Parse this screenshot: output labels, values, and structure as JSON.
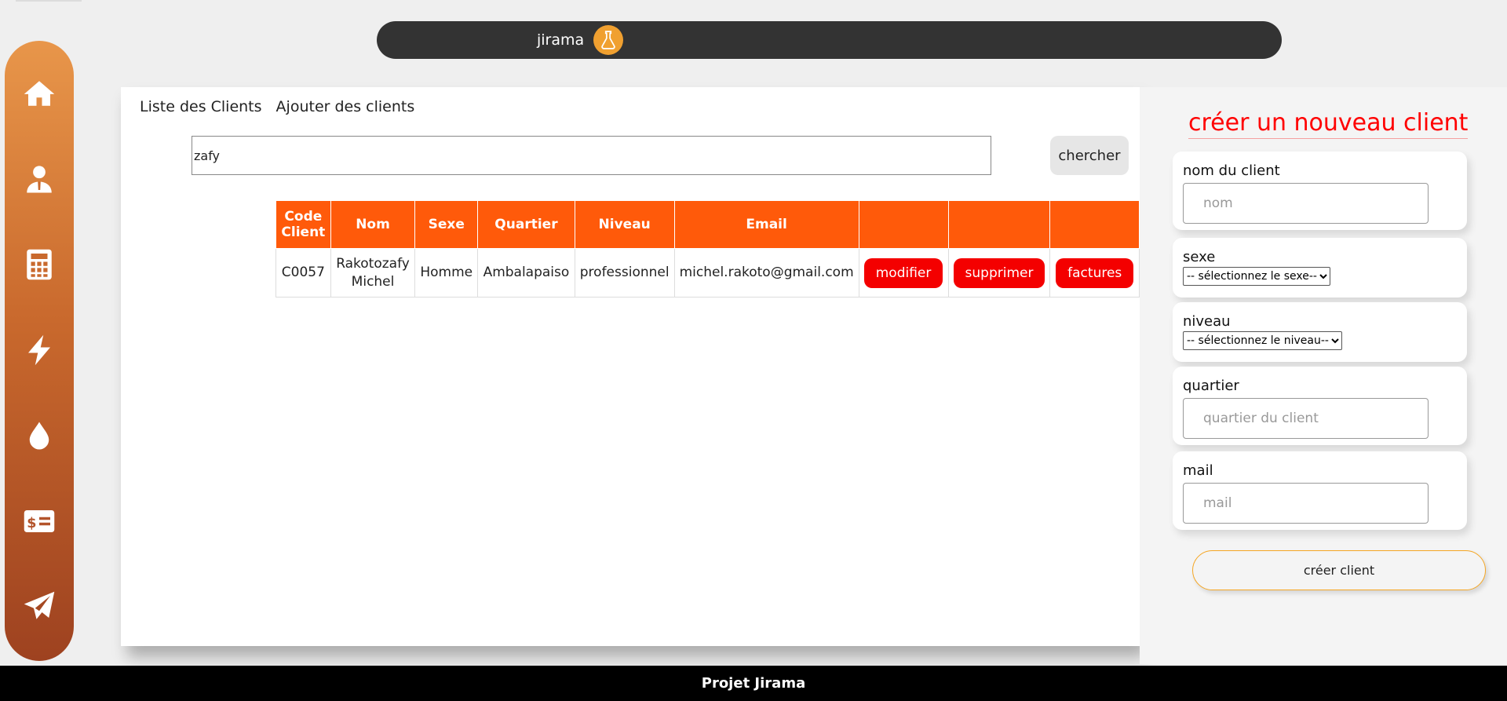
{
  "header": {
    "title": "jirama"
  },
  "sidebar": {
    "items": [
      "home-icon",
      "user-tie-icon",
      "calculator-icon",
      "bolt-icon",
      "droplet-icon",
      "money-bill-icon",
      "paper-plane-icon"
    ]
  },
  "tabs": {
    "list": "Liste des Clients",
    "add": "Ajouter des clients"
  },
  "search": {
    "value": "zafy",
    "button": "chercher"
  },
  "table": {
    "headers": [
      "Code Client",
      "Nom",
      "Sexe",
      "Quartier",
      "Niveau",
      "Email",
      "",
      "",
      ""
    ],
    "rows": [
      {
        "code": "C0057",
        "nom": "Rakotozafy Michel",
        "sexe": "Homme",
        "quartier": "Ambalapaiso",
        "niveau": "professionnel",
        "email": "michel.rakoto@gmail.com",
        "modifier": "modifier",
        "supprimer": "supprimer",
        "factures": "factures"
      }
    ]
  },
  "form": {
    "title": "créer un nouveau client",
    "nom_label": "nom du client",
    "nom_placeholder": "nom",
    "sexe_label": "sexe",
    "sexe_selected": "-- sélectionnez le sexe--",
    "niveau_label": "niveau",
    "niveau_selected": "-- sélectionnez le niveau--",
    "quartier_label": "quartier",
    "quartier_placeholder": "quartier du client",
    "mail_label": "mail",
    "mail_placeholder": "mail",
    "submit": "créer client"
  },
  "footer": {
    "text": "Projet Jirama"
  },
  "colors": {
    "accent": "#ff5a0a",
    "danger": "#f40000",
    "title_red": "#ff0000",
    "topbar": "#333333"
  }
}
